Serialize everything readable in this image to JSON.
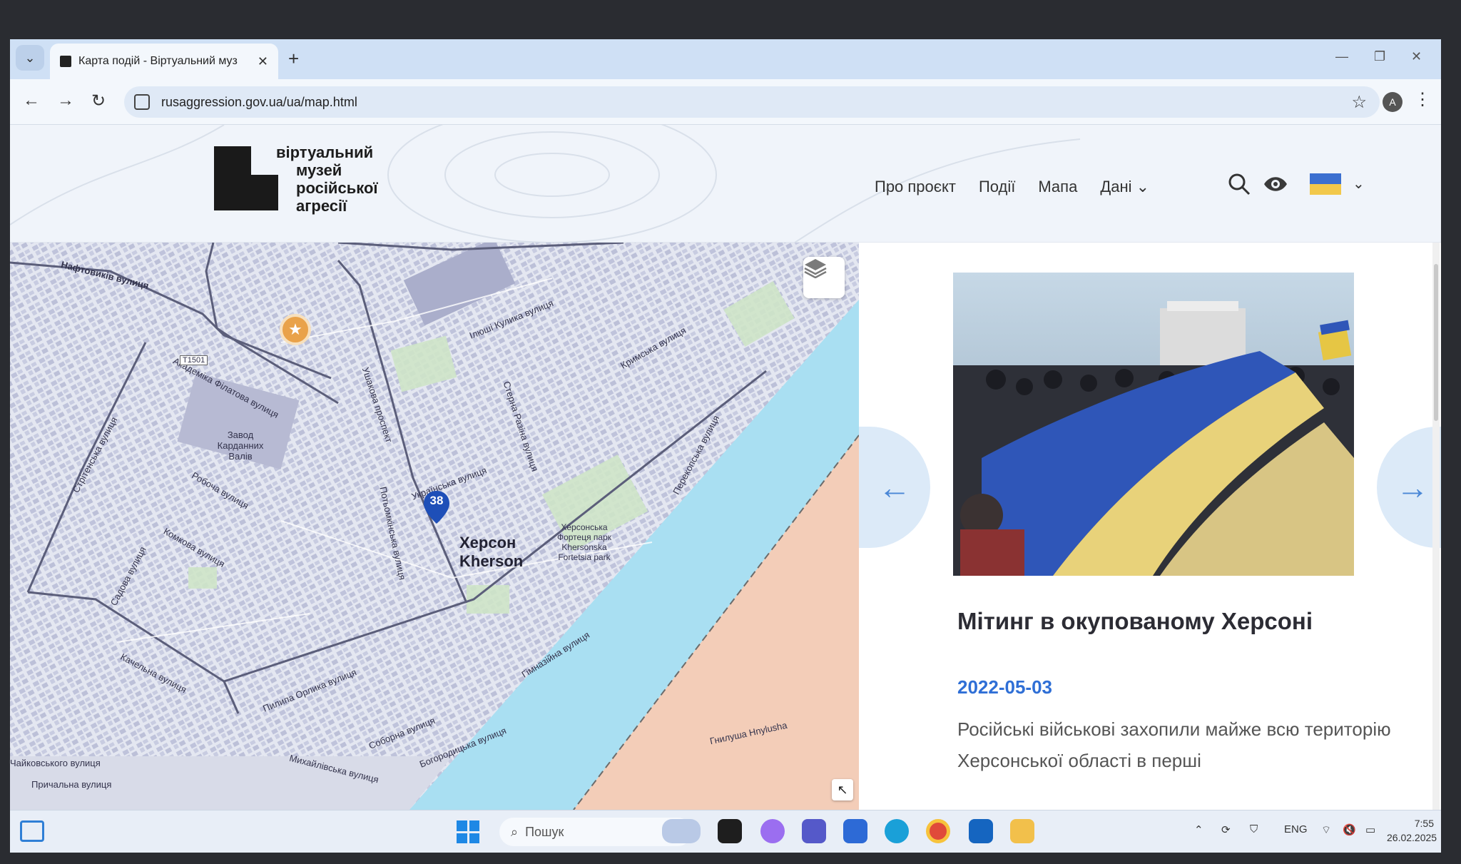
{
  "browser": {
    "tab_title": "Карта подій - Віртуальний муз",
    "url": "rusaggression.gov.ua/ua/map.html",
    "profile_initial": "A"
  },
  "site": {
    "logo_lines": [
      "віртуальний",
      "музей",
      "російської",
      "агресії"
    ],
    "nav": {
      "about": "Про проєкт",
      "events": "Події",
      "map": "Мапа",
      "data": "Дані"
    }
  },
  "map": {
    "marker_count": "38",
    "city_label_ua": "Херсон",
    "city_label_en": "Kherson",
    "labels": {
      "naftovykiv": "Нафтовиків вулиця",
      "kulyka": "Ілюші Кулика вулиця",
      "ushakova": "Ушакова проспект",
      "akademika": "Академіка Філатова вулиця",
      "zavod": "Завод Карданних Валів",
      "robocha": "Робоча вулиця",
      "komkova": "Комкова вулиця",
      "ukrainska": "Українська вулиця",
      "sterna": "Стерна Разіна вулиця",
      "fortress": "Херсонська Фортеця парк Khersonska Fortetsia park",
      "krymska": "Кримська вулиця",
      "perekopska": "Перекопська вулиця",
      "orlyka": "Пилипа Орлика вулиця",
      "kachelna": "Качельна вулиця",
      "sadova": "Садова вулиця",
      "sobroma": "Соборна вулиця",
      "bogorodytska": "Богородицька вулиця",
      "mykhailivska": "Михайлівська вулиця",
      "prychalna": "Причальна вулиця",
      "chaikovskoho": "Чайковського вулиця",
      "gymnazijna": "Гімназійна вулиця",
      "hnylusha": "Гнилуша Hnylusha",
      "strytenska": "Стрітенська вулиця",
      "t1501": "T1501",
      "potomkinska": "Потьомкінська вулиця"
    }
  },
  "event": {
    "title": "Мітинг в окупованому Херсоні",
    "date": "2022-05-03",
    "description": "Російські військові захопили майже всю територію Херсонської області в перші"
  },
  "taskbar": {
    "search_placeholder": "Пошук",
    "lang": "ENG",
    "time": "7:55",
    "date": "26.02.2025"
  },
  "colors": {
    "accent": "#2f6fd6",
    "flag_blue": "#3b6fd0",
    "flag_yellow": "#f2c84b",
    "water": "#a9dff2",
    "occupied": "#f3cdb8"
  }
}
